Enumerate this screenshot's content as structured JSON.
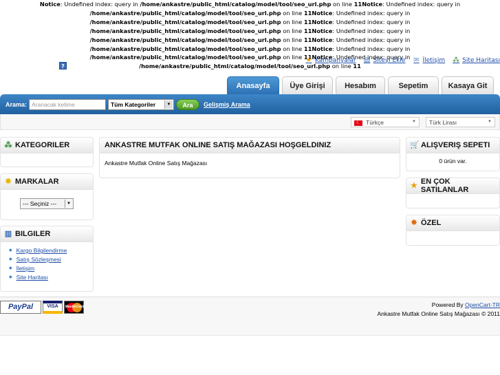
{
  "notices": [
    {
      "lead": "Notice",
      "text": ": Undefined index: query in ",
      "path": "/home/ankastre/public_html/catalog/model/tool/seo_url.php",
      "tail": " on line ",
      "line": "11"
    },
    {
      "lead": "Notice",
      "text": ": Undefined index: query in ",
      "path": "/home/ankastre/public_html/catalog/model/tool/seo_url.php",
      "tail": " on line ",
      "line": "11"
    },
    {
      "lead": "Notice",
      "text": ": Undefined index: query in ",
      "path": "/home/ankastre/public_html/catalog/model/tool/seo_url.php",
      "tail": " on line ",
      "line": "11"
    },
    {
      "lead": "Notice",
      "text": ": Undefined index: query in ",
      "path": "/home/ankastre/public_html/catalog/model/tool/seo_url.php",
      "tail": " on line ",
      "line": "11"
    },
    {
      "lead": "Notice",
      "text": ": Undefined index: query in ",
      "path": "/home/ankastre/public_html/catalog/model/tool/seo_url.php",
      "tail": " on line ",
      "line": "11"
    },
    {
      "lead": "Notice",
      "text": ": Undefined index: query in ",
      "path": "/home/ankastre/public_html/catalog/model/tool/seo_url.php",
      "tail": " on line ",
      "line": "11"
    },
    {
      "lead": "Notice",
      "text": ": Undefined index: query in ",
      "path": "/home/ankastre/public_html/catalog/model/tool/seo_url.php",
      "tail": " on line ",
      "line": "11"
    },
    {
      "lead": "Notice",
      "text": ": Undefined index: query in ",
      "path": "/home/ankastre/public_html/catalog/model/tool/seo_url.php",
      "tail": " on line ",
      "line": "11"
    }
  ],
  "help_icon": "?",
  "top_links": [
    {
      "label": "Kampanyalar",
      "icon": "star-icon",
      "glyph": "★",
      "color": "#e8a20c"
    },
    {
      "label": "Siteyi Ekle",
      "icon": "bookmark-icon",
      "glyph": "▤",
      "color": "#4a77b4"
    },
    {
      "label": "İletişim",
      "icon": "mail-icon",
      "glyph": "✉",
      "color": "#6a8cc0"
    },
    {
      "label": "Site Haritası",
      "icon": "sitemap-icon",
      "glyph": "⁂",
      "color": "#3c8a3c"
    }
  ],
  "tabs": [
    {
      "label": "Anasayfa",
      "active": true
    },
    {
      "label": "Üye Girişi",
      "active": false
    },
    {
      "label": "Hesabım",
      "active": false
    },
    {
      "label": "Sepetim",
      "active": false
    },
    {
      "label": "Kasaya Git",
      "active": false
    }
  ],
  "search": {
    "label": "Arama:",
    "placeholder": "Aranacak kelime",
    "category": "Tüm Kategoriler",
    "button": "Ara",
    "advanced": "Gelişmiş Arama"
  },
  "language": {
    "flag": "☾",
    "selected": "Türkçe"
  },
  "currency": {
    "selected": "Türk Lirası"
  },
  "left": {
    "categories_title": "KATEGORILER",
    "brands_title": "MARKALAR",
    "brands_select": "--- Seçiniz ---",
    "info_title": "BILGILER",
    "info_links": [
      "Kargo Bilgilendirme",
      "Satış Sözleşmesi",
      "İletişim",
      "Site Haritası"
    ]
  },
  "center": {
    "title": "ANKASTRE MUTFAK ONLINE SATIŞ MAĞAZASI HOŞGELDINIZ",
    "text": "Ankastre Mutfak Online Satış Mağazası"
  },
  "right": {
    "cart_title": "ALIŞVERIŞ SEPETI",
    "cart_text": "0 ürün var.",
    "bestsellers_title": "EN ÇOK SATILANLAR",
    "special_title": "ÖZEL"
  },
  "footer": {
    "powered_prefix": "Powered By ",
    "powered_link": "OpenCart-TR",
    "copyright": "Ankastre Mutfak Online Satış Mağazası © 2011",
    "payments": [
      "PayPal",
      "VISA",
      "MasterCard"
    ]
  }
}
